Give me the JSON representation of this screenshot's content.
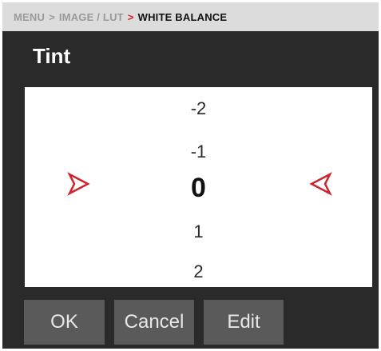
{
  "breadcrumb": {
    "items": [
      "MENU",
      "IMAGE / LUT",
      "WHITE BALANCE"
    ],
    "separator": ">"
  },
  "title": "Tint",
  "picker": {
    "values": [
      "-2",
      "-1",
      "0",
      "1",
      "2"
    ],
    "selected": "0",
    "left_indicator": "right-pointing-arrow-icon",
    "right_indicator": "left-pointing-arrow-icon"
  },
  "buttons": {
    "ok": "OK",
    "cancel": "Cancel",
    "edit": "Edit"
  },
  "colors": {
    "accent": "#d2222d",
    "background": "#2a2a2a",
    "button": "#5a5a5a",
    "breadcrumb_bg": "#dcdcdc"
  }
}
